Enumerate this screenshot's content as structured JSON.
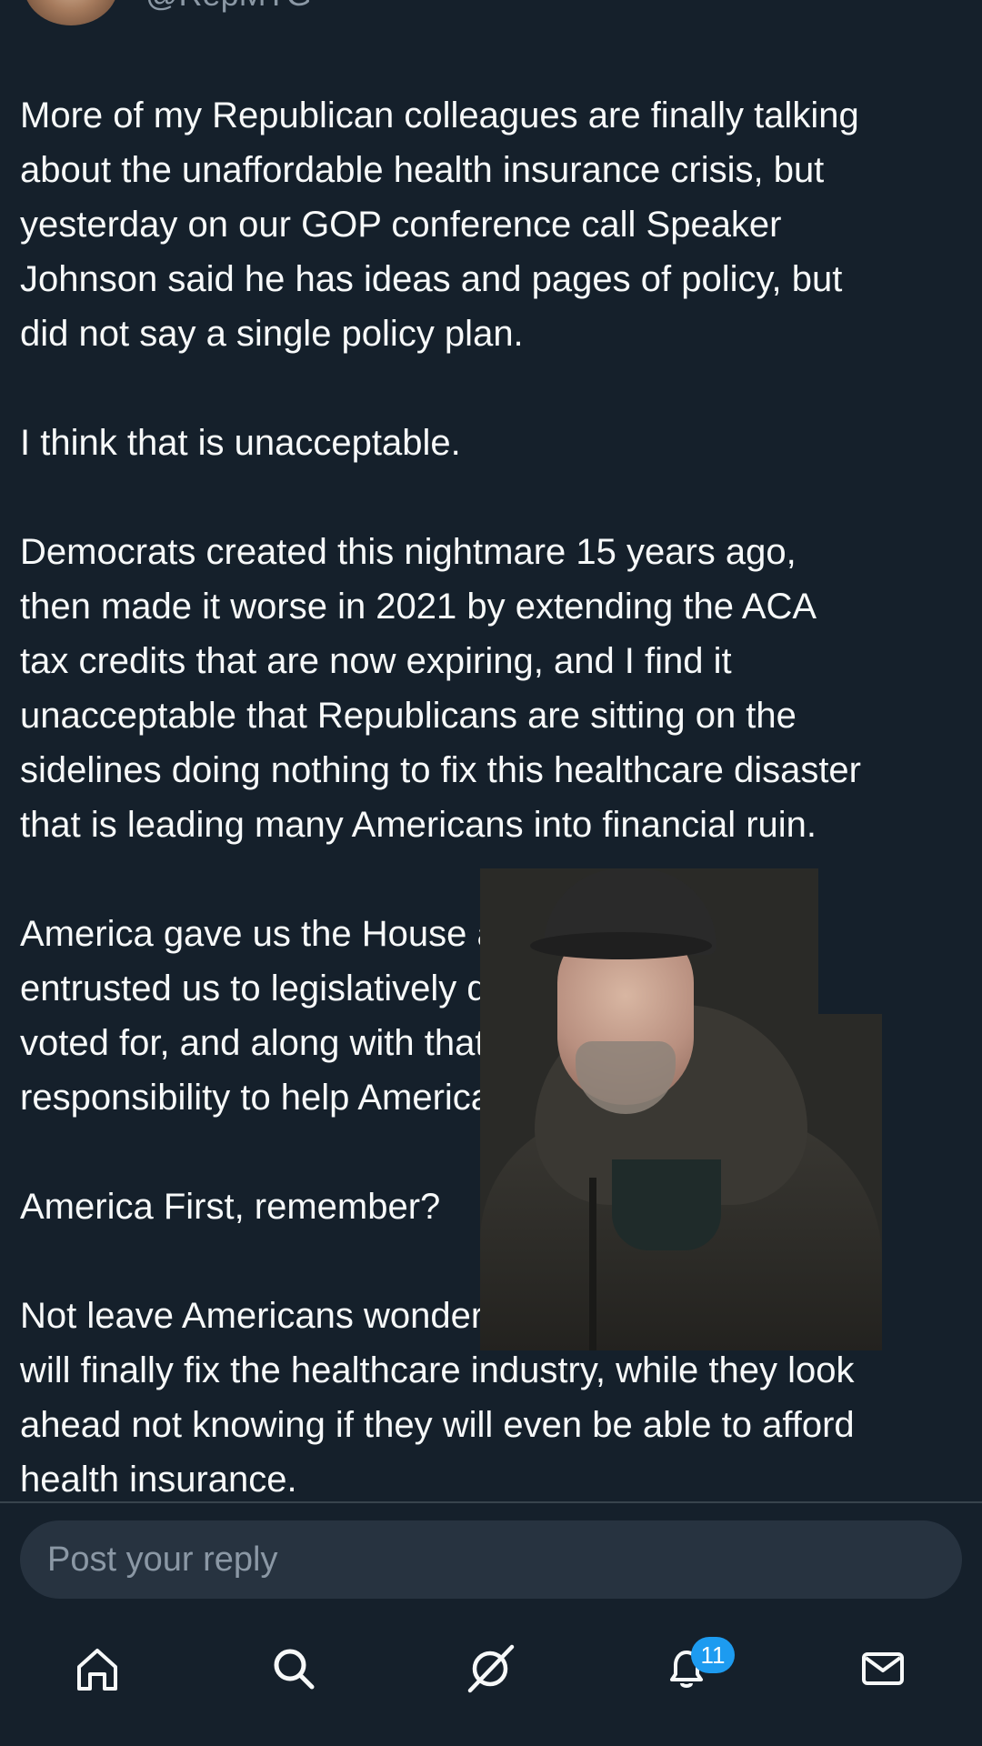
{
  "author": {
    "handle": "@RepMTG"
  },
  "tweet": {
    "paragraphs": [
      {
        "lines": [
          "More of my Republican colleagues are finally talking",
          "about the unaffordable health insurance crisis, but",
          "yesterday on our GOP conference call Speaker",
          "Johnson said he has ideas and pages of policy, but",
          "did not say a single policy plan."
        ]
      },
      {
        "lines": [
          "I think that is unacceptable."
        ]
      },
      {
        "lines": [
          "Democrats created this nightmare 15 years ago,",
          "then made it worse in 2021 by extending the ACA",
          "tax credits that are now expiring, and I find it",
          "unacceptable that Republicans are sitting on the",
          "sidelines doing nothing to fix this healthcare disaster",
          "that is leading many Americans into financial ruin."
        ]
      },
      {
        "lines": [
          "America gave us the House and Senate majority and",
          "entrusted us to legislatively deliver the agenda they",
          "voted for, and along with that comes the",
          "responsibility to help Americans."
        ]
      },
      {
        "lines": [
          "America First, remember?"
        ]
      },
      {
        "lines": [
          "Not leave Americans wondering when Congress",
          "will finally fix the healthcare industry, while they look",
          "ahead not knowing if they will even be able to afford",
          "health insurance."
        ]
      }
    ]
  },
  "reply": {
    "placeholder": "Post your reply"
  },
  "nav": {
    "items": [
      {
        "name": "home",
        "icon": "home-icon"
      },
      {
        "name": "search",
        "icon": "search-icon"
      },
      {
        "name": "grok",
        "icon": "grok-icon"
      },
      {
        "name": "notifications",
        "icon": "bell-icon"
      },
      {
        "name": "messages",
        "icon": "mail-icon"
      }
    ],
    "notification_count": "11"
  },
  "colors": {
    "background": "#15202b",
    "text": "#f7f9f9",
    "muted": "#8b98a5",
    "accent": "#1d9bf0",
    "reply_box": "#273340"
  }
}
